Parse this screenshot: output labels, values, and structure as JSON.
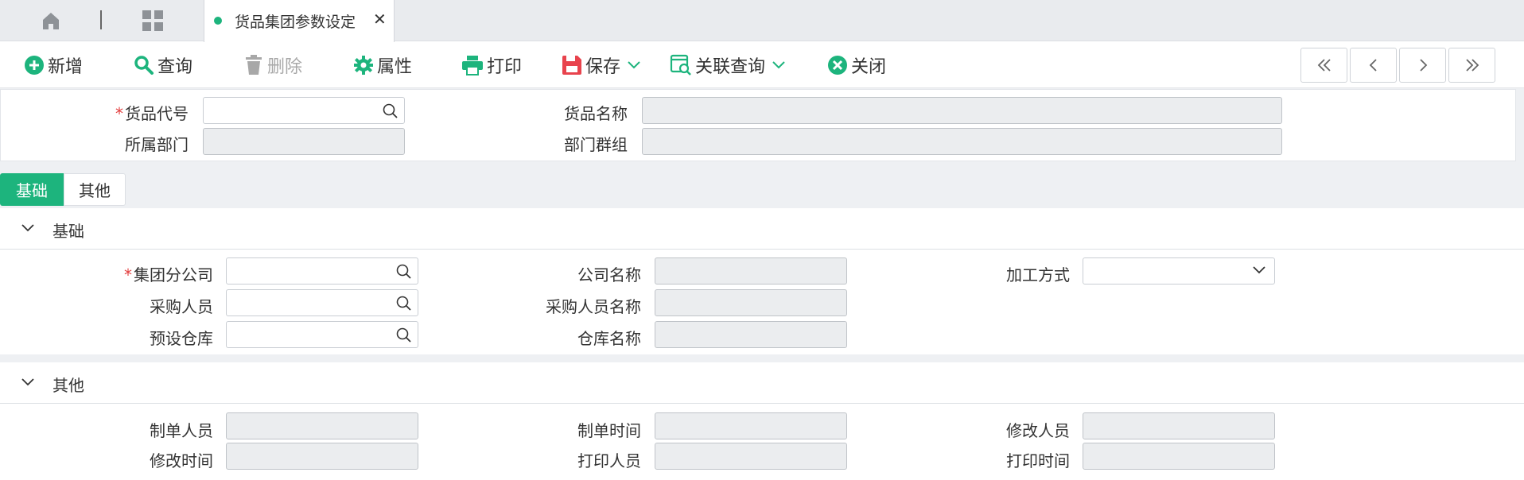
{
  "tabbar": {
    "home_icon": "home-icon",
    "grid_icon": "grid-icon",
    "active_tab": {
      "label": "货品集团参数设定",
      "close": "✕"
    }
  },
  "toolbar": {
    "add": "新增",
    "query": "查询",
    "delete": "删除",
    "properties": "属性",
    "print": "打印",
    "save": "保存",
    "related_query": "关联查询",
    "close": "关闭",
    "nav": [
      "«",
      "‹",
      "›",
      "»"
    ]
  },
  "header": {
    "goods_code": {
      "label": "货品代号",
      "value": ""
    },
    "goods_name": {
      "label": "货品名称",
      "value": ""
    },
    "department": {
      "label": "所属部门",
      "value": ""
    },
    "dept_group": {
      "label": "部门群组",
      "value": ""
    }
  },
  "subtabs": [
    "基础",
    "其他"
  ],
  "basic": {
    "title": "基础",
    "group_branch": {
      "label": "集团分公司",
      "value": ""
    },
    "company_name": {
      "label": "公司名称",
      "value": ""
    },
    "process_method": {
      "label": "加工方式",
      "value": ""
    },
    "buyer": {
      "label": "采购人员",
      "value": ""
    },
    "buyer_name": {
      "label": "采购人员名称",
      "value": ""
    },
    "default_warehouse": {
      "label": "预设仓库",
      "value": ""
    },
    "warehouse_name": {
      "label": "仓库名称",
      "value": ""
    }
  },
  "other": {
    "title": "其他",
    "creator": {
      "label": "制单人员",
      "value": ""
    },
    "create_time": {
      "label": "制单时间",
      "value": ""
    },
    "modifier": {
      "label": "修改人员",
      "value": ""
    },
    "modify_time": {
      "label": "修改时间",
      "value": ""
    },
    "printer": {
      "label": "打印人员",
      "value": ""
    },
    "print_time": {
      "label": "打印时间",
      "value": ""
    }
  },
  "colors": {
    "accent": "#1db47d",
    "required": "#e23b3b",
    "save_icon": "#e8434d",
    "delete_disabled": "#a8a8a8"
  }
}
